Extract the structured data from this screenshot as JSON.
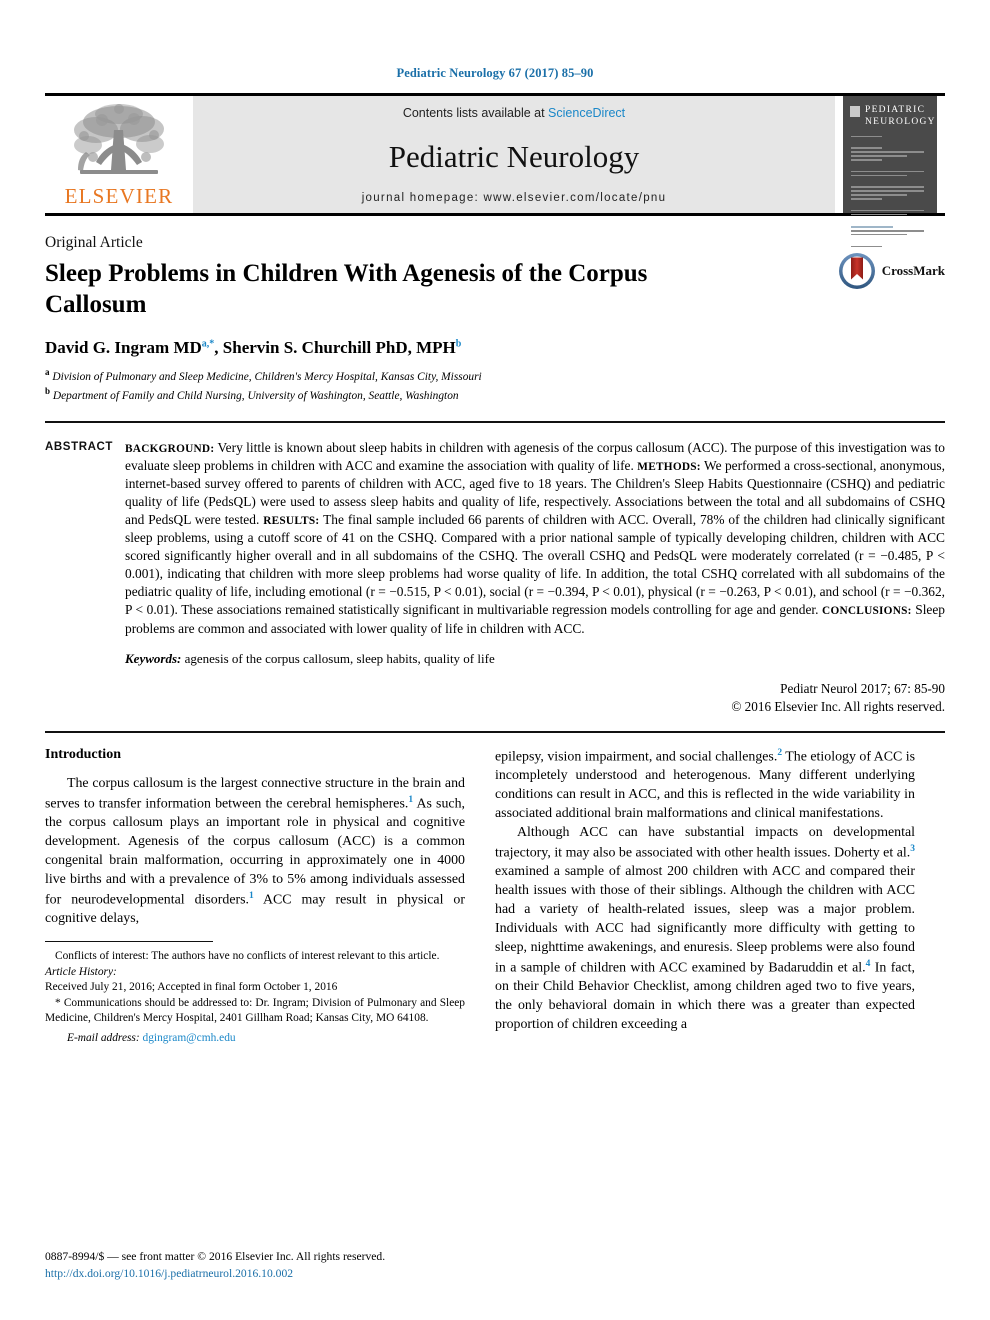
{
  "running_head": "Pediatric Neurology 67 (2017) 85–90",
  "masthead": {
    "contents_prefix": "Contents lists available at ",
    "sciencedirect": "ScienceDirect",
    "journal_name": "Pediatric Neurology",
    "homepage": "journal homepage: www.elsevier.com/locate/pnu",
    "publisher_logo_text": "ELSEVIER",
    "cover_title_line1": "PEDIATRIC",
    "cover_title_line2": "NEUROLOGY"
  },
  "article": {
    "type": "Original Article",
    "title": "Sleep Problems in Children With Agenesis of the Corpus Callosum",
    "authors_html": "David G. Ingram MD<sup>a,&#42;</sup>, Shervin S. Churchill PhD, MPH<sup>b</sup>",
    "affiliation_a": "Division of Pulmonary and Sleep Medicine, Children's Mercy Hospital, Kansas City, Missouri",
    "affiliation_b": "Department of Family and Child Nursing, University of Washington, Seattle, Washington",
    "crossmark_label": "CrossMark"
  },
  "abstract": {
    "label": "ABSTRACT",
    "background_label": "BACKGROUND:",
    "background": "Very little is known about sleep habits in children with agenesis of the corpus callosum (ACC). The purpose of this investigation was to evaluate sleep problems in children with ACC and examine the association with quality of life.",
    "methods_label": "METHODS:",
    "methods": "We performed a cross-sectional, anonymous, internet-based survey offered to parents of children with ACC, aged five to 18 years. The Children's Sleep Habits Questionnaire (CSHQ) and pediatric quality of life (PedsQL) were used to assess sleep habits and quality of life, respectively. Associations between the total and all subdomains of CSHQ and PedsQL were tested.",
    "results_label": "RESULTS:",
    "results": "The final sample included 66 parents of children with ACC. Overall, 78% of the children had clinically significant sleep problems, using a cutoff score of 41 on the CSHQ. Compared with a prior national sample of typically developing children, children with ACC scored significantly higher overall and in all subdomains of the CSHQ. The overall CSHQ and PedsQL were moderately correlated (r = −0.485, P < 0.001), indicating that children with more sleep problems had worse quality of life. In addition, the total CSHQ correlated with all subdomains of the pediatric quality of life, including emotional (r = −0.515, P < 0.01), social (r = −0.394, P < 0.01), physical (r = −0.263, P < 0.01), and school (r = −0.362, P < 0.01). These associations remained statistically significant in multivariable regression models controlling for age and gender.",
    "conclusions_label": "CONCLUSIONS:",
    "conclusions": "Sleep problems are common and associated with lower quality of life in children with ACC.",
    "keywords_label": "Keywords:",
    "keywords": "agenesis of the corpus callosum, sleep habits, quality of life",
    "citation": "Pediatr Neurol 2017; 67: 85-90",
    "copyright": "© 2016 Elsevier Inc. All rights reserved."
  },
  "body": {
    "intro_heading": "Introduction",
    "left_p1_a": "The corpus callosum is the largest connective structure in the brain and serves to transfer information between the cerebral hemispheres.",
    "left_p1_ref1": "1",
    "left_p1_b": " As such, the corpus callosum plays an important role in physical and cognitive development. Agenesis of the corpus callosum (ACC) is a common congenital brain malformation, occurring in approximately one in 4000 live births and with a prevalence of 3% to 5% among individuals assessed for neurodevelopmental disorders.",
    "left_p1_ref2": "1",
    "left_p1_c": " ACC may result in physical or cognitive delays,",
    "right_p1_a": "epilepsy, vision impairment, and social challenges.",
    "right_p1_ref": "2",
    "right_p1_b": " The etiology of ACC is incompletely understood and heterogenous. Many different underlying conditions can result in ACC, and this is reflected in the wide variability in associated additional brain malformations and clinical manifestations.",
    "right_p2_a": "Although ACC can have substantial impacts on developmental trajectory, it may also be associated with other health issues. Doherty et al.",
    "right_p2_ref1": "3",
    "right_p2_b": " examined a sample of almost 200 children with ACC and compared their health issues with those of their siblings. Although the children with ACC had a variety of health-related issues, sleep was a major problem. Individuals with ACC had significantly more difficulty with getting to sleep, nighttime awakenings, and enuresis. Sleep problems were also found in a sample of children with ACC examined by Badaruddin et al.",
    "right_p2_ref2": "4",
    "right_p2_c": " In fact, on their Child Behavior Checklist, among children aged two to five years, the only behavioral domain in which there was a greater than expected proportion of children exceeding a"
  },
  "footnotes": {
    "conflicts": "Conflicts of interest: The authors have no conflicts of interest relevant to this article.",
    "history_label": "Article History:",
    "history": "Received July 21, 2016; Accepted in final form October 1, 2016",
    "correspondence": "* Communications should be addressed to: Dr. Ingram; Division of Pulmonary and Sleep Medicine, Children's Mercy Hospital, 2401 Gillham Road; Kansas City, MO 64108.",
    "email_label": "E-mail address:",
    "email": "dgingram@cmh.edu"
  },
  "footer": {
    "issn_line": "0887-8994/$ — see front matter © 2016 Elsevier Inc. All rights reserved.",
    "doi": "http://dx.doi.org/10.1016/j.pediatrneurol.2016.10.002"
  },
  "colors": {
    "link_blue": "#1a87c8",
    "header_blue": "#1a6fa8",
    "elsevier_orange": "#E87722",
    "masthead_gray": "#e6e6e6",
    "cover_gray": "#4a4a4a",
    "crossmark_blue": "#3b6ea5",
    "crossmark_red": "#b52b23"
  }
}
